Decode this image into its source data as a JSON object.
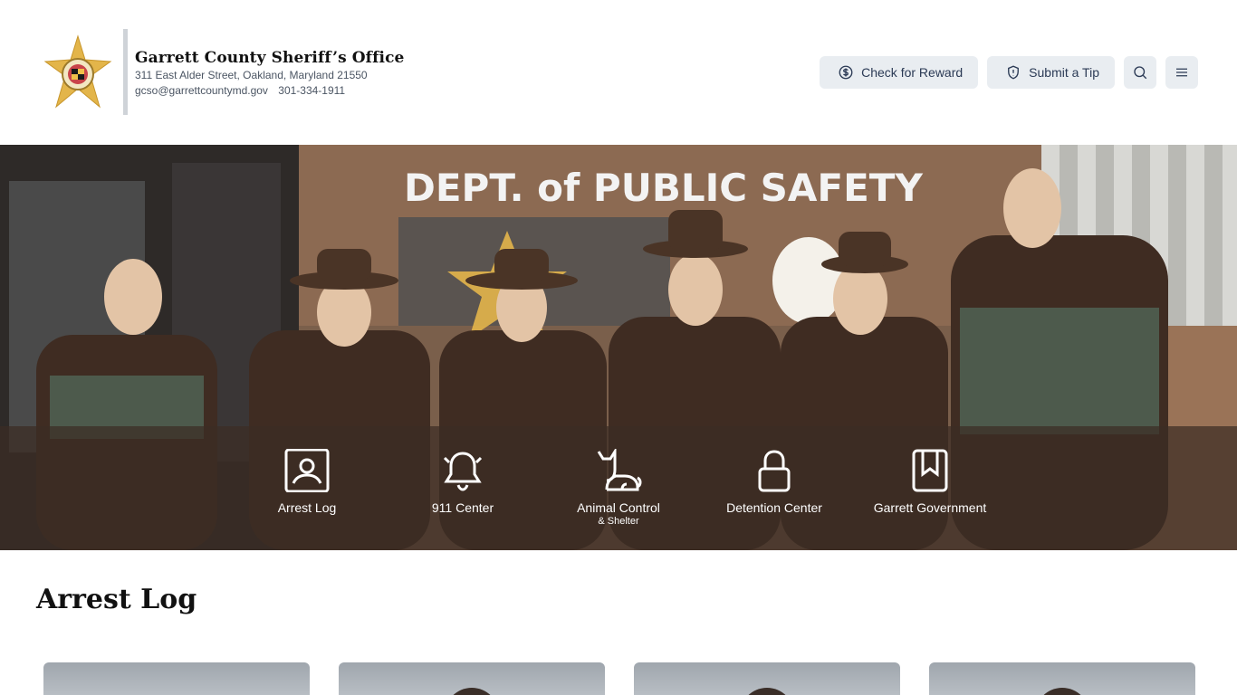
{
  "header": {
    "title": "Garrett County Sheriff’s Office",
    "address": "311 East Alder Street, Oakland, Maryland 21550",
    "email": "gcso@garrettcountymd.gov",
    "phone": "301-334-1911",
    "actions": {
      "reward_label": "Check for Reward",
      "tip_label": "Submit a Tip"
    }
  },
  "hero": {
    "sign_text": "DEPT. of PUBLIC SAFETY",
    "quick_links": [
      {
        "label": "Arrest Log",
        "sub": "",
        "icon": "portrait-icon"
      },
      {
        "label": "911 Center",
        "sub": "",
        "icon": "bell-icon"
      },
      {
        "label": "Animal Control",
        "sub": "& Shelter",
        "icon": "cat-icon"
      },
      {
        "label": "Detention Center",
        "sub": "",
        "icon": "lock-icon"
      },
      {
        "label": "Garrett Government",
        "sub": "",
        "icon": "bookmark-icon"
      }
    ]
  },
  "section": {
    "title": "Arrest Log"
  },
  "colors": {
    "button_bg": "#e9edf1",
    "button_text": "#2b3a55",
    "overlay": "#3c2c24",
    "badge_gold": "#e3b54a"
  }
}
